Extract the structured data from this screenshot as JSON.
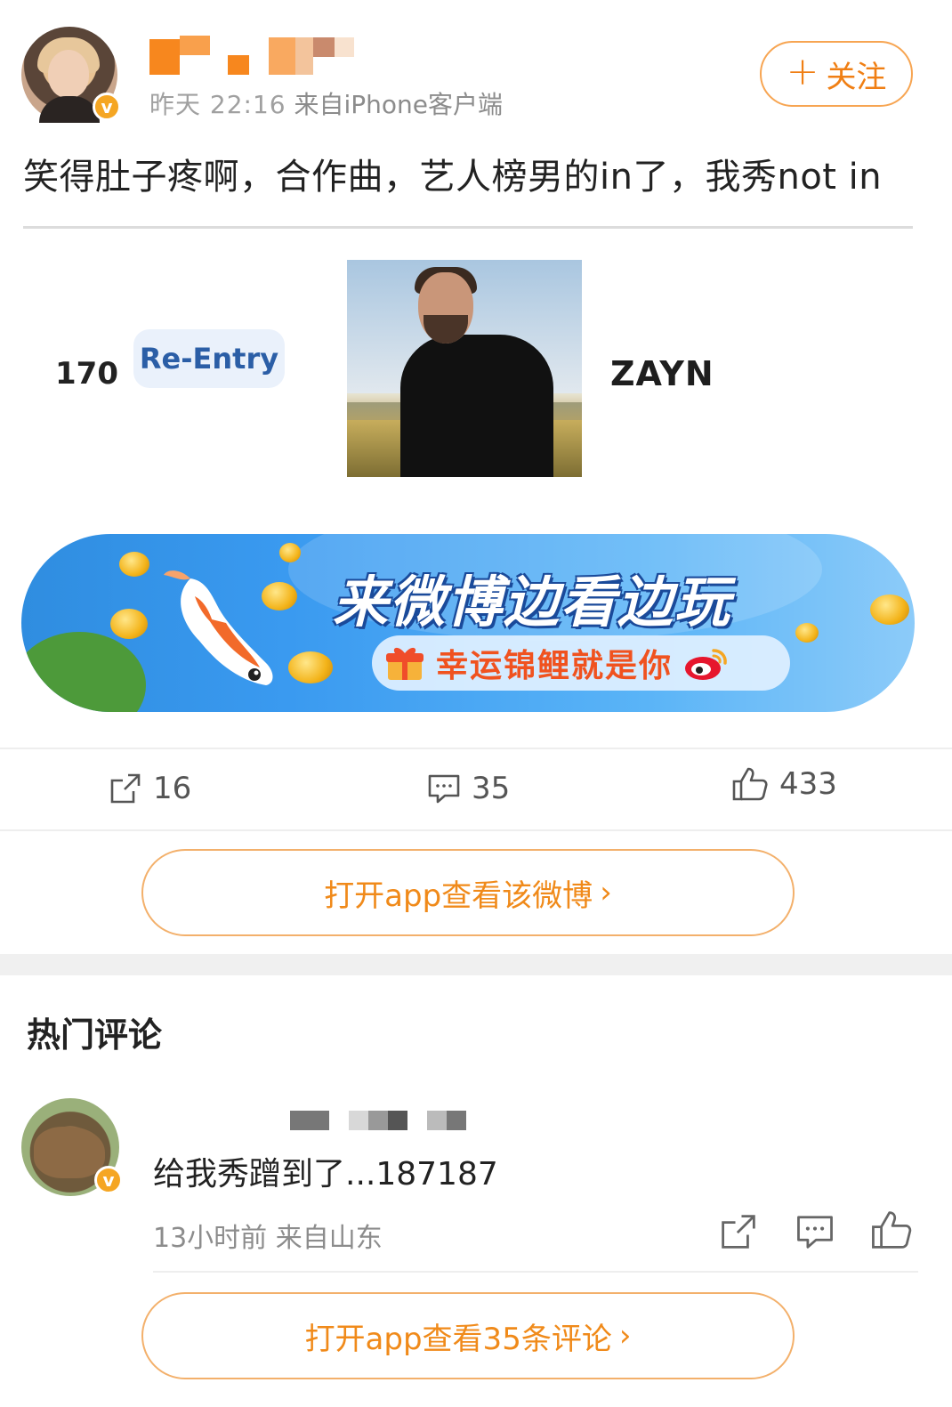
{
  "post": {
    "meta_time": "昨天 22:16",
    "meta_source": "来自iPhone客户端",
    "follow_label": "关注",
    "text": "笑得肚子疼啊，合作曲，艺人榜男的in了，我秀not in",
    "chart_entry": {
      "rank": "170",
      "status": "Re-Entry",
      "artist": "ZAYN"
    },
    "banner": {
      "title": "来微博边看边玩",
      "subtitle": "幸运锦鲤就是你"
    },
    "actions": {
      "reposts": "16",
      "comments": "35",
      "likes": "433"
    },
    "open_app_label": "打开app查看该微博"
  },
  "hot_comments": {
    "title": "热门评论",
    "items": [
      {
        "text": "给我秀蹭到了...187187",
        "meta": "13小时前 来自山东"
      }
    ],
    "open_all_label": "打开app查看35条评论"
  },
  "colors": {
    "accent": "#f07f14",
    "verified": "#f5a623",
    "banner_blue": "#3a9af0"
  }
}
